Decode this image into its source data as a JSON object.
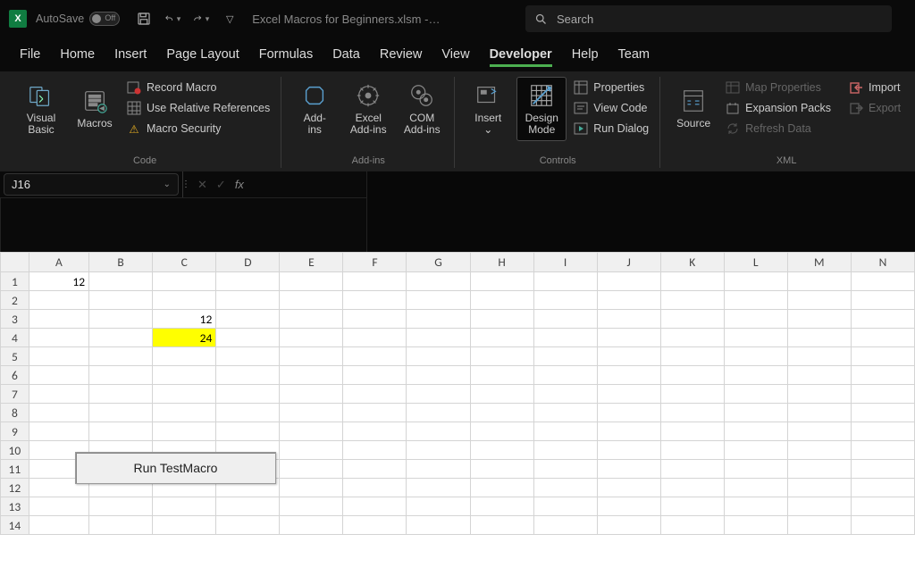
{
  "title": {
    "autosave": "AutoSave",
    "toggle_state": "Off",
    "filename": "Excel Macros for Beginners.xlsm",
    "suffix": "-…"
  },
  "search": {
    "placeholder": "Search"
  },
  "tabs": [
    "File",
    "Home",
    "Insert",
    "Page Layout",
    "Formulas",
    "Data",
    "Review",
    "View",
    "Developer",
    "Help",
    "Team"
  ],
  "active_tab": "Developer",
  "ribbon": {
    "code": {
      "visual_basic": "Visual\nBasic",
      "macros": "Macros",
      "record": "Record Macro",
      "relative": "Use Relative References",
      "security": "Macro Security",
      "label": "Code"
    },
    "addins": {
      "addins": "Add-\nins",
      "excel": "Excel\nAdd-ins",
      "com": "COM\nAdd-ins",
      "label": "Add-ins"
    },
    "controls": {
      "insert": "Insert",
      "design": "Design\nMode",
      "properties": "Properties",
      "view_code": "View Code",
      "run_dialog": "Run Dialog",
      "label": "Controls"
    },
    "xml": {
      "source": "Source",
      "map": "Map Properties",
      "expansion": "Expansion Packs",
      "refresh": "Refresh Data",
      "import": "Import",
      "export": "Export",
      "label": "XML"
    }
  },
  "namebox": "J16",
  "columns": [
    "A",
    "B",
    "C",
    "D",
    "E",
    "F",
    "G",
    "H",
    "I",
    "J",
    "K",
    "L",
    "M",
    "N"
  ],
  "rows": 14,
  "cells": {
    "A1": "12",
    "C3": "12",
    "C4": "24"
  },
  "highlight": {
    "C4": "yellow"
  },
  "macro_button": "Run TestMacro"
}
